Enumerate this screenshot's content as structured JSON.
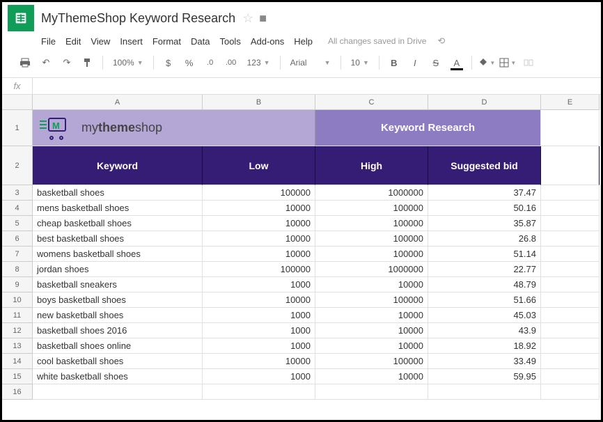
{
  "doc_title": "MyThemeShop Keyword Research",
  "menus": [
    "File",
    "Edit",
    "View",
    "Insert",
    "Format",
    "Data",
    "Tools",
    "Add-ons",
    "Help"
  ],
  "saved_text": "All changes saved in Drive",
  "toolbar": {
    "zoom": "100%",
    "font": "Arial",
    "size": "10",
    "number_fmt": "123"
  },
  "fx_label": "fx",
  "columns": [
    "A",
    "B",
    "C",
    "D",
    "E"
  ],
  "brand": {
    "my": "my",
    "theme": "theme",
    "shop": "shop"
  },
  "title_right": "Keyword Research",
  "headers": {
    "a": "Keyword",
    "b": "Low",
    "c": "High",
    "d": "Suggested bid"
  },
  "rows": [
    {
      "n": "3",
      "a": "basketball shoes",
      "b": "100000",
      "c": "1000000",
      "d": "37.47"
    },
    {
      "n": "4",
      "a": "mens basketball shoes",
      "b": "10000",
      "c": "100000",
      "d": "50.16"
    },
    {
      "n": "5",
      "a": "cheap basketball shoes",
      "b": "10000",
      "c": "100000",
      "d": "35.87"
    },
    {
      "n": "6",
      "a": "best basketball shoes",
      "b": "10000",
      "c": "100000",
      "d": "26.8"
    },
    {
      "n": "7",
      "a": "womens basketball shoes",
      "b": "10000",
      "c": "100000",
      "d": "51.14"
    },
    {
      "n": "8",
      "a": "jordan shoes",
      "b": "100000",
      "c": "1000000",
      "d": "22.77"
    },
    {
      "n": "9",
      "a": "basketball sneakers",
      "b": "1000",
      "c": "10000",
      "d": "48.79"
    },
    {
      "n": "10",
      "a": "boys basketball shoes",
      "b": "10000",
      "c": "100000",
      "d": "51.66"
    },
    {
      "n": "11",
      "a": "new basketball shoes",
      "b": "1000",
      "c": "10000",
      "d": "45.03"
    },
    {
      "n": "12",
      "a": "basketball shoes 2016",
      "b": "1000",
      "c": "10000",
      "d": "43.9"
    },
    {
      "n": "13",
      "a": "basketball shoes online",
      "b": "1000",
      "c": "10000",
      "d": "18.92"
    },
    {
      "n": "14",
      "a": "cool basketball shoes",
      "b": "10000",
      "c": "100000",
      "d": "33.49"
    },
    {
      "n": "15",
      "a": "white basketball shoes",
      "b": "1000",
      "c": "10000",
      "d": "59.95"
    }
  ],
  "row_nums": {
    "r1": "1",
    "r2": "2",
    "r16": "16"
  }
}
